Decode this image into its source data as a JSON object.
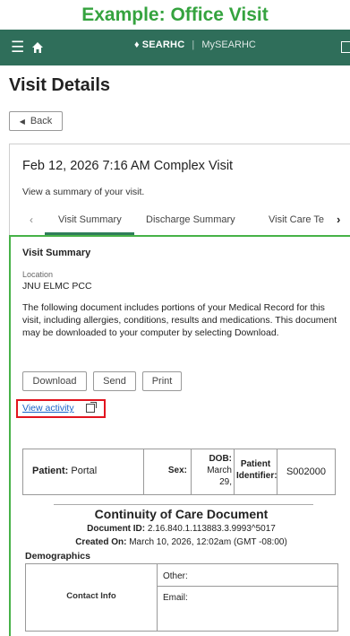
{
  "caption": "Example: Office Visit",
  "app": {
    "menu_icon": "hamburger-icon",
    "home_icon": "home-icon",
    "brand": "SEARHC",
    "separator": "|",
    "portal_name": "MySEARHC",
    "exit_icon": "sign-out-icon"
  },
  "page": {
    "title": "Visit Details",
    "back_label": "Back"
  },
  "visit": {
    "title": "Feb 12, 2026 7:16 AM Complex Visit",
    "subtitle": "View a summary of your visit."
  },
  "tabs": {
    "items": [
      "Visit Summary",
      "Discharge Summary",
      "Visit Care Te"
    ],
    "active": "Visit Summary",
    "prev_icon": "chevron-left-icon",
    "next_icon": "chevron-right-icon"
  },
  "summary": {
    "section_title": "Visit Summary",
    "location_label": "Location",
    "location_value": "JNU ELMC PCC",
    "description": "The following document includes portions of your Medical Record for this visit, including allergies, conditions, results and medications. This document may be downloaded to your computer by selecting Download.",
    "buttons": {
      "download": "Download",
      "send": "Send",
      "print": "Print"
    },
    "view_activity": "View activity",
    "highlight_color": "#e2141f"
  },
  "patient": {
    "patient_label": "Patient:",
    "patient_value": "Portal",
    "sex_label": "Sex:",
    "dob_label": "DOB:",
    "dob_line1": "March",
    "dob_line2": "29,",
    "id_label_line1": "Patient",
    "id_label_line2": "Identifier:",
    "id_value": "S002000"
  },
  "ccd": {
    "title": "Continuity of Care Document",
    "doc_id_label": "Document ID:",
    "doc_id_value": "2.16.840.1.113883.3.9993^5017",
    "created_label": "Created On:",
    "created_value": "March 10, 2026, 12:02am (GMT -08:00)",
    "demographics": "Demographics",
    "contact_info": "Contact Info",
    "other_label": "Other:",
    "email_label": "Email:"
  },
  "colors": {
    "topbar": "#2f6e5a",
    "caption": "#35a33f",
    "panel_border": "#47b248",
    "link": "#1a63c9"
  }
}
